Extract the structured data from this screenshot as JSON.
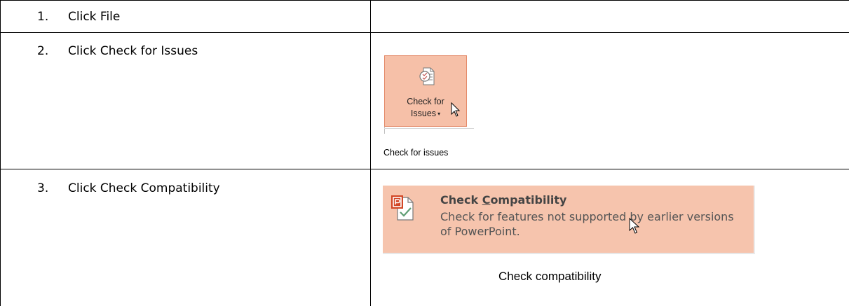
{
  "steps": [
    {
      "number": "1.",
      "text": "Click File"
    },
    {
      "number": "2.",
      "text": "Click Check for Issues"
    },
    {
      "number": "3.",
      "text": "Click Check Compatibility"
    }
  ],
  "check_for_issues": {
    "button_line1": "Check for",
    "button_line2": "Issues",
    "dropdown_arrow": "▾",
    "caption": "Check for issues",
    "icon": "document-check-icon",
    "highlight_color": "#f6c0a8"
  },
  "check_compatibility": {
    "title_prefix": "Check ",
    "title_underlined": "C",
    "title_rest": "ompatibility",
    "description": "Check for features not supported by earlier versions of PowerPoint.",
    "caption": "Check compatibility",
    "icon": "powerpoint-compatibility-icon",
    "highlight_color": "#f6c4ad"
  }
}
